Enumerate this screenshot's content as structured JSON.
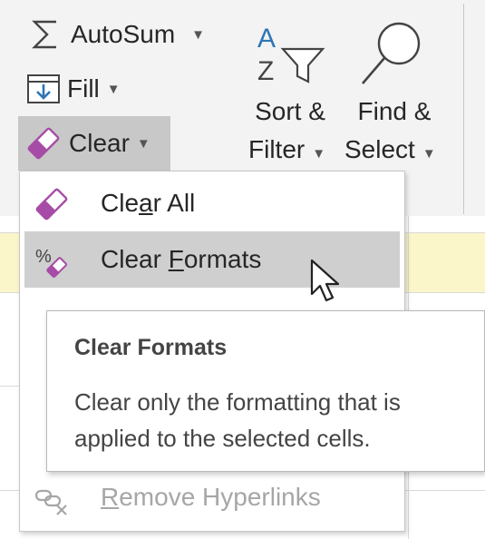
{
  "ribbon": {
    "autosum": {
      "label": "AutoSum",
      "icon": "sigma-icon"
    },
    "fill": {
      "label": "Fill",
      "icon": "fill-down-icon"
    },
    "clear": {
      "label": "Clear",
      "icon": "eraser-icon"
    },
    "sort_filter": {
      "line1": "Sort &",
      "line2": "Filter",
      "icon": "sort-filter-icon"
    },
    "find_select": {
      "line1": "Find &",
      "line2": "Select",
      "icon": "magnifier-icon"
    }
  },
  "menu": {
    "items": [
      {
        "pre": "Cle",
        "accel": "a",
        "post": "r All",
        "icon": "eraser-icon",
        "state": "normal"
      },
      {
        "pre": "Clear ",
        "accel": "F",
        "post": "ormats",
        "icon": "clear-formats-icon",
        "state": "hover"
      },
      {
        "pre": "",
        "accel": "R",
        "post": "emove Hyperlinks",
        "icon": "remove-hyperlink-icon",
        "state": "disabled"
      }
    ]
  },
  "tooltip": {
    "title": "Clear Formats",
    "line1": "Clear only the formatting that is",
    "line2": "applied to the selected cells."
  },
  "colors": {
    "ribbon_bg": "#f3f3f3",
    "hover_bg": "#cfcfcf",
    "selection_yellow": "#fbf6c9",
    "icon_blue": "#2e75b6",
    "eraser_purple": "#a64ca6"
  }
}
